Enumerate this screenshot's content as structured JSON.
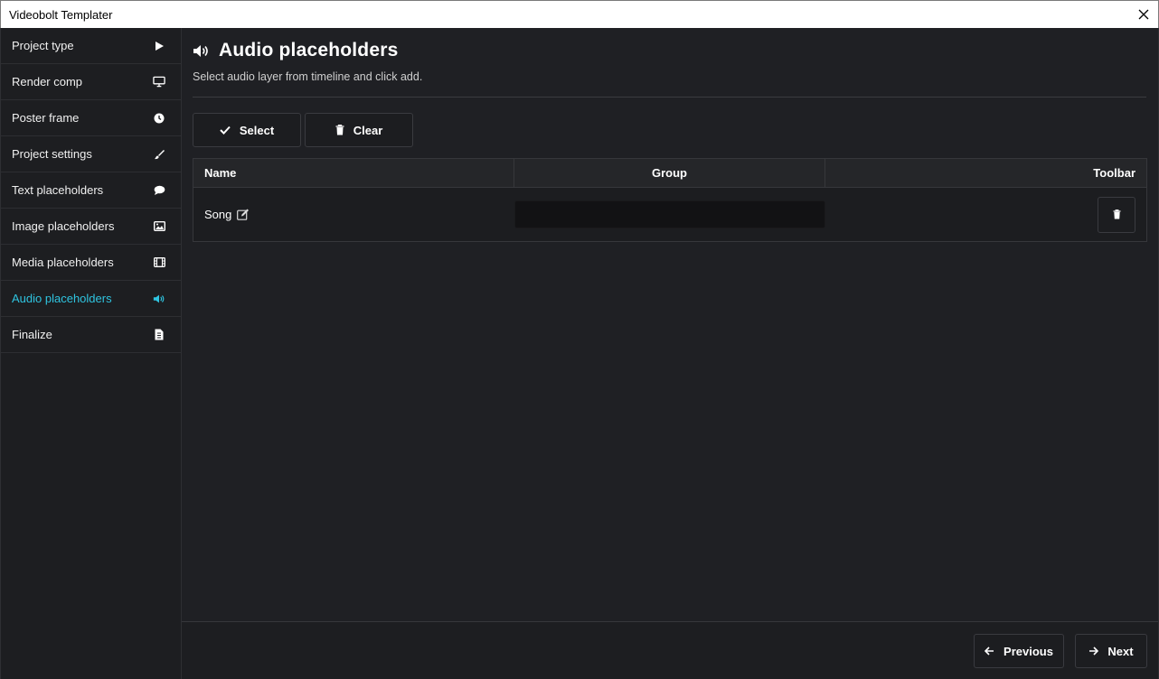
{
  "window": {
    "title": "Videobolt Templater"
  },
  "sidebar": {
    "items": [
      {
        "label": "Project type",
        "icon": "play-icon"
      },
      {
        "label": "Render comp",
        "icon": "monitor-icon"
      },
      {
        "label": "Poster frame",
        "icon": "clock-icon"
      },
      {
        "label": "Project settings",
        "icon": "brush-icon"
      },
      {
        "label": "Text placeholders",
        "icon": "comment-icon"
      },
      {
        "label": "Image placeholders",
        "icon": "image-icon"
      },
      {
        "label": "Media placeholders",
        "icon": "film-icon"
      },
      {
        "label": "Audio placeholders",
        "icon": "volume-icon",
        "active": true
      },
      {
        "label": "Finalize",
        "icon": "document-icon"
      }
    ]
  },
  "main": {
    "title": "Audio placeholders",
    "subtitle": "Select audio layer from timeline and click add.",
    "buttons": {
      "select": "Select",
      "clear": "Clear"
    },
    "table": {
      "headers": {
        "name": "Name",
        "group": "Group",
        "toolbar": "Toolbar"
      },
      "rows": [
        {
          "name": "Song",
          "group": ""
        }
      ]
    }
  },
  "footer": {
    "previous": "Previous",
    "next": "Next"
  },
  "colors": {
    "accent": "#2fc4e0",
    "background": "#1f2024",
    "sidebar": "#1d1e21"
  }
}
